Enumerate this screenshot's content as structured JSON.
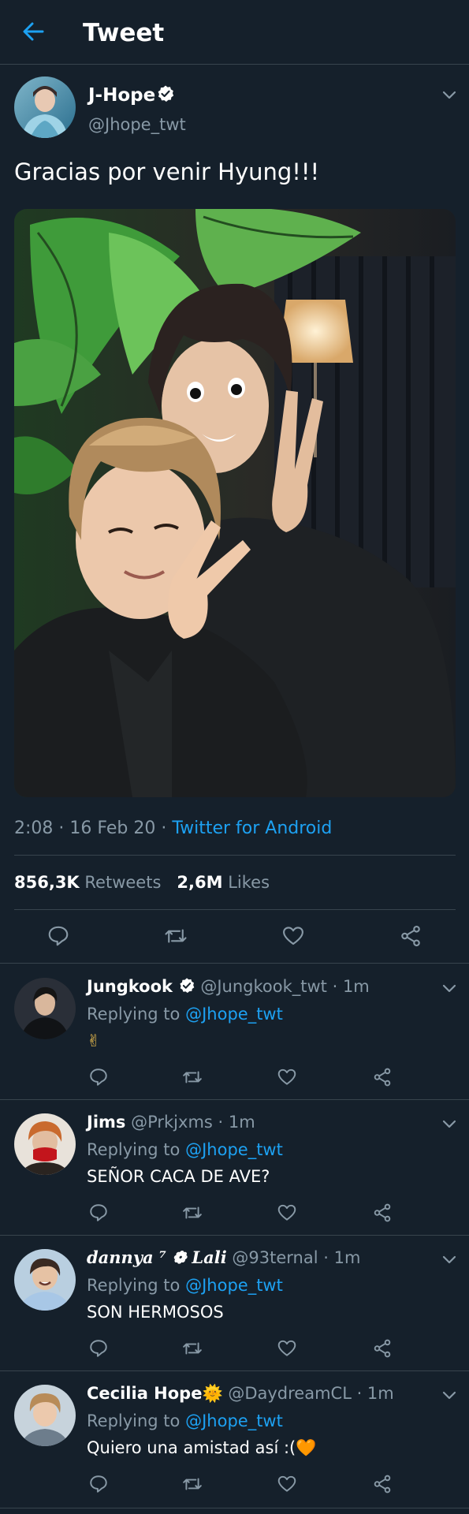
{
  "header": {
    "title": "Tweet"
  },
  "tweet": {
    "name": "J-Hope",
    "handle": "@Jhope_twt",
    "text": "Gracias por venir Hyung!!!",
    "time": "2:08",
    "date": "16 Feb 20",
    "source": "Twitter for Android",
    "retweets_count": "856,3K",
    "retweets_label": "Retweets",
    "likes_count": "2,6M",
    "likes_label": "Likes"
  },
  "replies": [
    {
      "name": "Jungkook",
      "verified": true,
      "handle": "@Jungkook_twt",
      "time": "1m",
      "replying_prefix": "Replying to",
      "replying_to": "@Jhope_twt",
      "text": "✌"
    },
    {
      "name": "Jims",
      "handle": "@Prkjxms",
      "time": "1m",
      "replying_prefix": "Replying to",
      "replying_to": "@Jhope_twt",
      "text": "SEÑOR CACA DE AVE?"
    },
    {
      "name": "dannya ⁷ ❁ Lali",
      "handle": "@93ternal",
      "time": "1m",
      "replying_prefix": "Replying to",
      "replying_to": "@Jhope_twt",
      "text": "SON HERMOSOS"
    },
    {
      "name": "Cecilia Hope",
      "name_emoji": "🌞",
      "handle": "@DaydreamCL",
      "time": "1m",
      "replying_prefix": "Replying to",
      "replying_to": "@Jhope_twt",
      "text": "Quiero una amistad así :(",
      "text_emoji": "🧡"
    }
  ],
  "icons": {
    "back": "arrow-left-icon",
    "verified": "verified-badge-icon",
    "more": "chevron-down-icon",
    "reply": "reply-icon",
    "retweet": "retweet-icon",
    "like": "heart-icon",
    "share": "share-icon"
  },
  "colors": {
    "background": "#15202b",
    "accent": "#1da1f2",
    "muted": "#8899a6",
    "divider": "#38444d",
    "text": "#ffffff"
  }
}
